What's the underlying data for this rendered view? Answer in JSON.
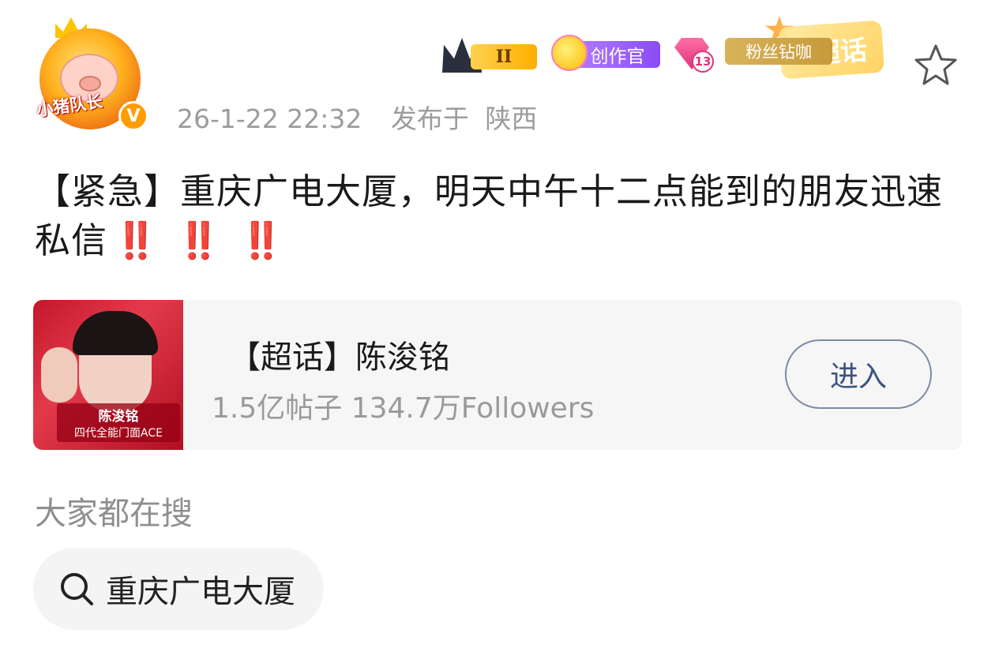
{
  "post": {
    "avatar_tag": "小猪队长",
    "verified_mark": "V",
    "timestamp": "26-1-22 22:32",
    "published_prefix": "发布于",
    "location": "陕西",
    "badges": {
      "level": "II",
      "creator": "创作官",
      "gem_level": "13",
      "fan": "粉丝钻咖",
      "supertopic_deco": "超话"
    },
    "text": "【紧急】重庆广电大厦，明天中午十二点能到的朋友迅速私信",
    "emphasis": "‼️ ‼️ ‼️"
  },
  "topic_card": {
    "thumb_name": "陈浚铭",
    "thumb_caption": "四代全能门面ACE",
    "title": "【超话】陈浚铭",
    "stats": "1.5亿帖子 134.7万Followers",
    "enter_label": "进入"
  },
  "search": {
    "heading": "大家都在搜",
    "chip_label": "重庆广电大厦"
  },
  "colors": {
    "emphasis_red": "#e6332a",
    "enter_text": "#3d5480",
    "meta_gray": "#9c9c9c"
  }
}
